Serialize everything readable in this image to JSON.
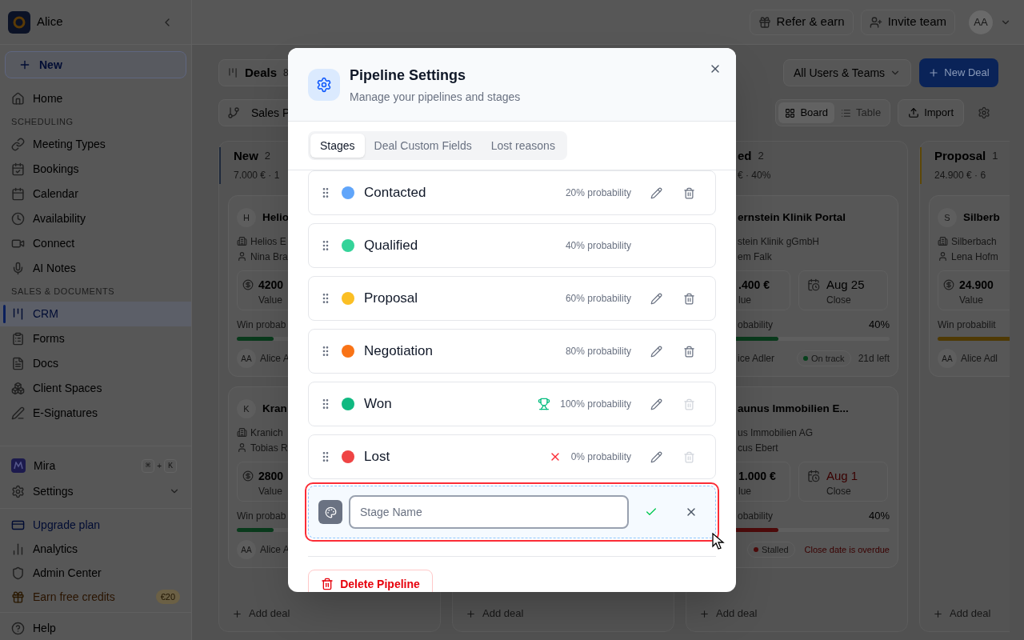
{
  "sidebar": {
    "workspace": "Alice",
    "new_button": "New",
    "nav": [
      {
        "kind": "item",
        "label": "Home",
        "selected": false
      },
      {
        "kind": "section",
        "label": "SCHEDULING"
      },
      {
        "kind": "item",
        "label": "Meeting Types",
        "selected": false
      },
      {
        "kind": "item",
        "label": "Bookings",
        "selected": false
      },
      {
        "kind": "item",
        "label": "Calendar",
        "selected": false
      },
      {
        "kind": "item",
        "label": "Availability",
        "selected": false
      },
      {
        "kind": "item",
        "label": "Connect",
        "selected": false
      },
      {
        "kind": "item",
        "label": "AI Notes",
        "selected": false
      },
      {
        "kind": "section",
        "label": "SALES & DOCUMENTS"
      },
      {
        "kind": "item",
        "label": "CRM",
        "selected": true
      },
      {
        "kind": "item",
        "label": "Forms",
        "selected": false
      },
      {
        "kind": "item",
        "label": "Docs",
        "selected": false
      },
      {
        "kind": "item",
        "label": "Client Spaces",
        "selected": false
      },
      {
        "kind": "item",
        "label": "E-Signatures",
        "selected": false
      }
    ],
    "assistant": {
      "label": "Mira",
      "keys": [
        "⌘",
        "K"
      ],
      "joiner": "+"
    },
    "settings": {
      "label": "Settings",
      "expanded": false
    },
    "footer": [
      {
        "kind": "upgrade",
        "label": "Upgrade plan"
      },
      {
        "kind": "plain",
        "label": "Analytics"
      },
      {
        "kind": "plain",
        "label": "Admin Center"
      },
      {
        "kind": "credits",
        "label": "Earn free credits",
        "badge": "€20"
      },
      {
        "kind": "help",
        "label": "Help"
      }
    ]
  },
  "topbar": {
    "buttons": [
      "Refer & earn",
      "Invite team"
    ],
    "avatar": "AA"
  },
  "toolbar": {
    "view_tab": {
      "label": "Deals",
      "count": "8"
    },
    "pipeline": "Sales P",
    "owner_filter": "All Users & Teams",
    "new_deal": "New Deal",
    "views": [
      {
        "label": "Board",
        "selected": true
      },
      {
        "label": "Table",
        "selected": false
      }
    ],
    "import": "Import"
  },
  "board": {
    "columns": [
      {
        "title": "New",
        "count": "2",
        "summary": "7.000 € · 1",
        "color": "#1e293b",
        "add_label": "Add deal",
        "cards": [
          {
            "initial": "H",
            "title": "Helio",
            "company": "Helios E",
            "contact": "Nina Bra",
            "value": "4200",
            "value_label": "Value",
            "prob_label": "Win probab",
            "level": 0.2,
            "color": "#0a3a1c",
            "owner_initials": "AA",
            "owner": "Alice A"
          },
          {
            "initial": "K",
            "title": "Kran",
            "company": "Kranich",
            "contact": "Tobias R",
            "value": "2800",
            "value_label": "Value",
            "prob_label": "Win probab",
            "level": 0.2,
            "color": "#0a3a1c",
            "owner_initials": "AA",
            "owner": "Alice A"
          }
        ]
      },
      {
        "add_label": "Add deal"
      },
      {
        "title": "ed",
        "count": "2",
        "summary": "€ · 40%",
        "add_label": "Add deal",
        "cards": [
          {
            "title": "ernstein Klinik Portal",
            "company": "stein Klinik gGmbH",
            "contact": "em Falk",
            "value": ".400 €",
            "value_label": "lue",
            "close": "Aug 25",
            "close_label": "Close",
            "close_overdue": false,
            "prob_label": "obability",
            "prob_value": "40%",
            "level": 0.4,
            "color": "#0a3a1c",
            "owner": "ice Adler",
            "status": {
              "label": "On track",
              "color": "#07401c"
            },
            "due": "21d left"
          },
          {
            "title": "aunus Immobilien E...",
            "company": "us Immobilien AG",
            "contact": "cus Ebert",
            "value": "1.000 €",
            "value_label": "lue",
            "close": "Aug 1",
            "close_label": "Close",
            "close_overdue": true,
            "prob_label": "obability",
            "prob_value": "40%",
            "level": 0.4,
            "color": "#4d0b0b",
            "status": {
              "label": "Stalled",
              "color": "#4d0b0b"
            },
            "warning": "Close date is overdue"
          }
        ]
      },
      {
        "title": "Proposal",
        "count": "1",
        "summary": "24.900 € · 6",
        "color": "#5c4708",
        "add_label": "Add deal",
        "cards": [
          {
            "initial": "S",
            "title": "Silberb",
            "company": "Silberbach",
            "contact": "Lena Hofm",
            "value": "24.900",
            "value_label": "Value",
            "prob_label": "Win probabilit",
            "level": 0.6,
            "color": "#4f3a05",
            "owner_initials": "AA",
            "owner": "Alice Adl"
          }
        ]
      }
    ]
  },
  "dialog": {
    "title": "Pipeline Settings",
    "subtitle": "Manage your pipelines and stages",
    "tabs": [
      {
        "label": "Stages",
        "selected": true
      },
      {
        "label": "Deal Custom Fields",
        "selected": false
      },
      {
        "label": "Lost reasons",
        "selected": false
      }
    ],
    "stages": [
      {
        "name": "Contacted",
        "color": "#60a5fa",
        "probability": "20% probability",
        "kind": "normal",
        "actions_shown": true,
        "delete_disabled": false
      },
      {
        "name": "Qualified",
        "color": "#34d399",
        "probability": "40% probability",
        "kind": "normal",
        "actions_shown": false
      },
      {
        "name": "Proposal",
        "color": "#fbbf24",
        "probability": "60% probability",
        "kind": "normal",
        "actions_shown": true,
        "delete_disabled": false
      },
      {
        "name": "Negotiation",
        "color": "#f97316",
        "probability": "80% probability",
        "kind": "normal",
        "actions_shown": true,
        "delete_disabled": false
      },
      {
        "name": "Won",
        "color": "#10b981",
        "probability": "100% probability",
        "kind": "won",
        "actions_shown": true,
        "delete_disabled": true
      },
      {
        "name": "Lost",
        "color": "#ef4444",
        "probability": "0% probability",
        "kind": "lost",
        "actions_shown": true,
        "delete_disabled": true
      }
    ],
    "new_stage": {
      "placeholder": "Stage Name",
      "highlighted": true
    },
    "delete_button": "Delete Pipeline"
  }
}
